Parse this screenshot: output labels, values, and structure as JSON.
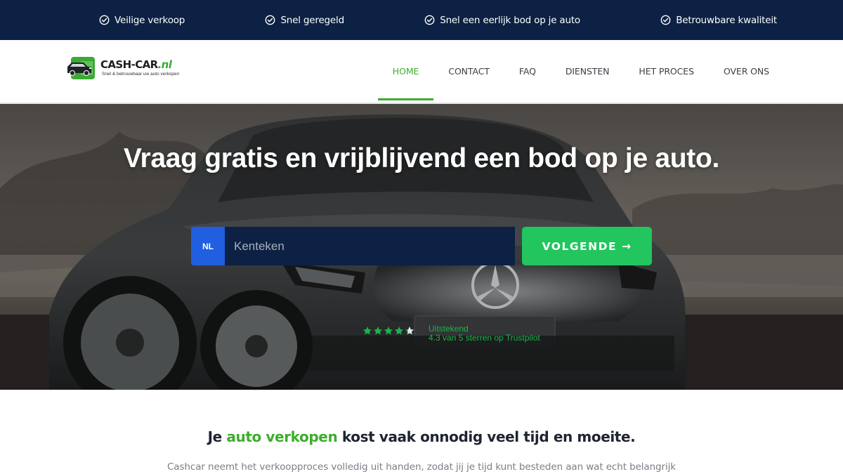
{
  "topbar": {
    "items": [
      {
        "label": "Veilige verkoop",
        "icon": "check-circle-icon"
      },
      {
        "label": "Snel geregeld",
        "icon": "check-circle-icon"
      },
      {
        "label": "Snel een eerlijk bod op je auto",
        "icon": "check-circle-icon"
      },
      {
        "label": "Betrouwbare kwaliteit",
        "icon": "check-circle-icon"
      }
    ]
  },
  "header": {
    "logo": {
      "name": "CASH-CAR",
      "tld": ".nl",
      "tagline": "Snel & betrouwbaar uw auto verkopen"
    },
    "nav": [
      {
        "label": "HOME",
        "active": true
      },
      {
        "label": "CONTACT",
        "active": false
      },
      {
        "label": "FAQ",
        "active": false
      },
      {
        "label": "DIENSTEN",
        "active": false
      },
      {
        "label": "HET PROCES",
        "active": false
      },
      {
        "label": "OVER ONS",
        "active": false
      }
    ]
  },
  "hero": {
    "title": "Vraag gratis en vrijblijvend een bod op je auto.",
    "country_code": "NL",
    "plate_placeholder": "Kenteken",
    "plate_value": "",
    "submit_label": "VOLGENDE →",
    "rating": {
      "score": 4.3,
      "max": 5,
      "label": "Uitstekend",
      "detail": "4.3 van 5 sterren op Trustpilot"
    }
  },
  "intro": {
    "title_before": "Je ",
    "title_highlight": "auto verkopen",
    "title_after": " kost vaak onnodig veel tijd en moeite.",
    "text": "Cashcar neemt het verkoopproces volledig uit handen, zodat jij je tijd kunt besteden aan wat echt belangrijk"
  },
  "colors": {
    "topbar_bg": "#0c2143",
    "accent_green": "#3cae2b",
    "button_green": "#22c55e",
    "nl_blue": "#1f5fe0",
    "input_navy": "#0c2143"
  }
}
